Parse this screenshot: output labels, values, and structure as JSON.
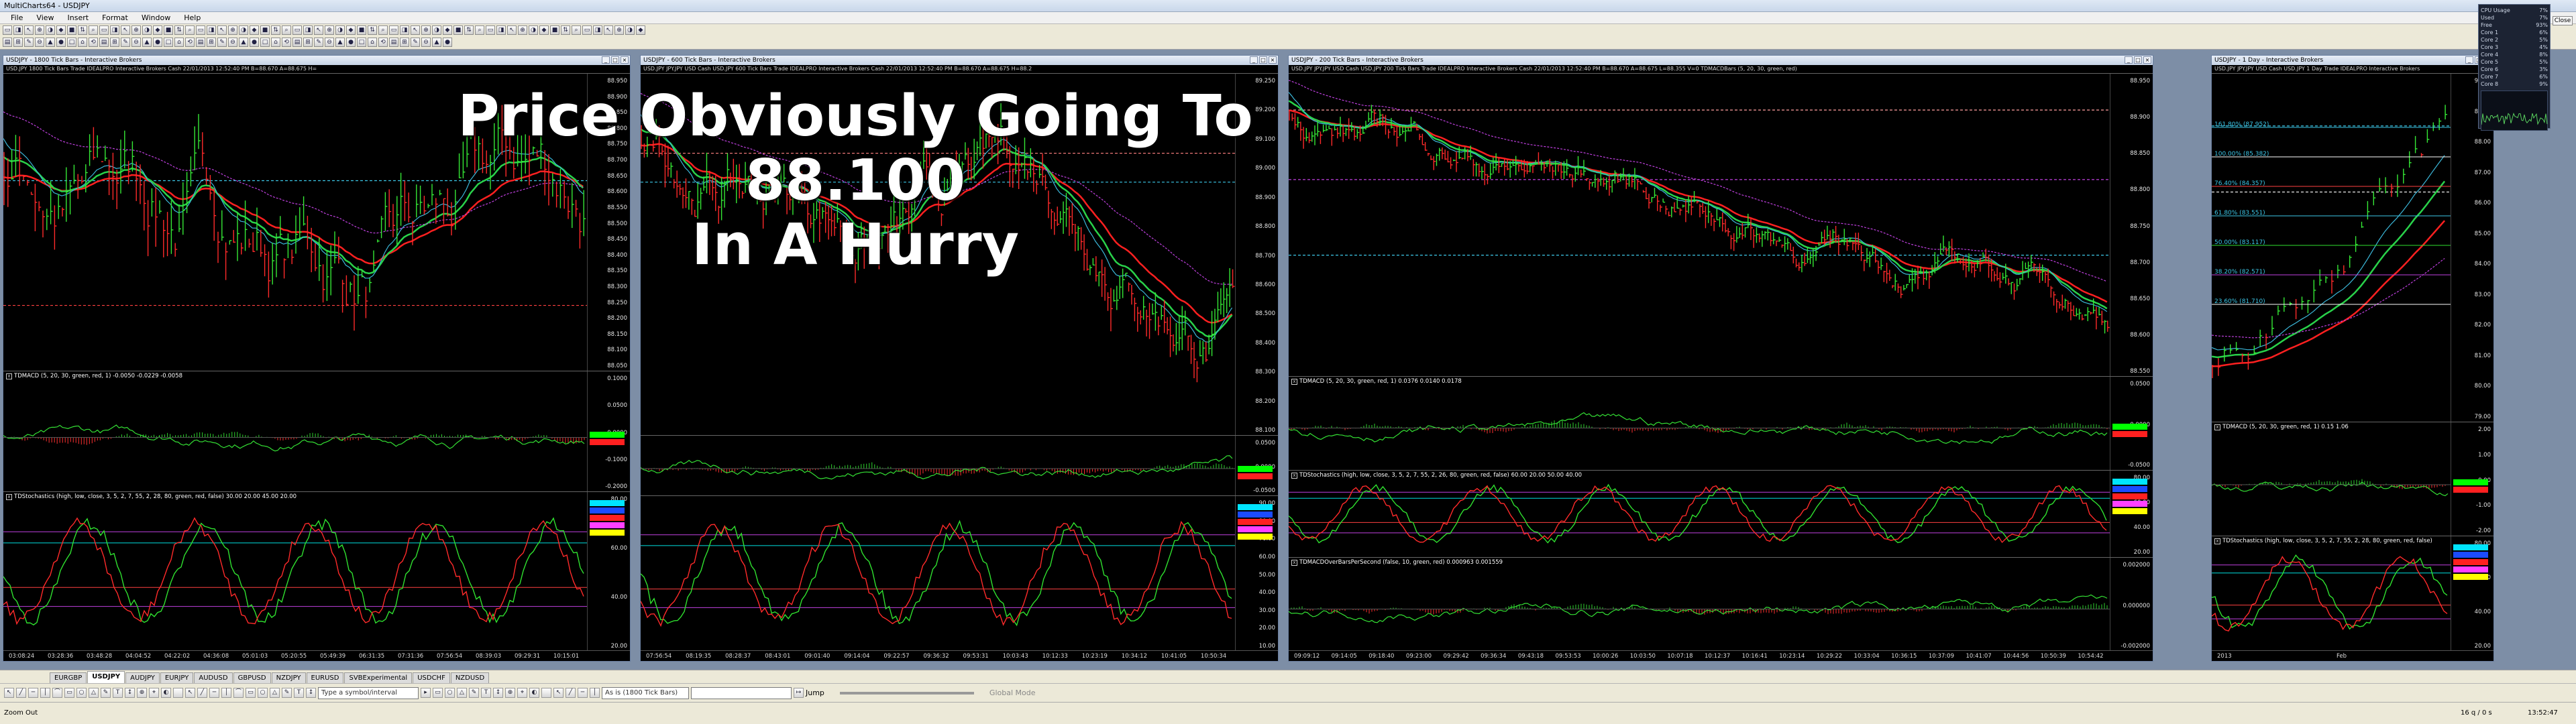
{
  "app": {
    "title": "MultiCharts64 - USDJPY"
  },
  "menu": [
    "File",
    "View",
    "Insert",
    "Format",
    "Window",
    "Help"
  ],
  "overlay": {
    "line1": "Price Obviously Going To 88.100",
    "line2": "In A Hurry"
  },
  "windows": [
    {
      "title": "USDJPY - 1800 Tick Bars - Interactive Brokers",
      "info": "USD.JPY  1800 Tick Bars   Trade  IDEALPRO  Interactive Brokers  Cash  22/01/2013  12:52:40 PM  B=88.670  A=88.675  H=",
      "prices": [
        "88.950",
        "88.900",
        "88.850",
        "88.800",
        "88.750",
        "88.700",
        "88.650",
        "88.600",
        "88.550",
        "88.500",
        "88.450",
        "88.400",
        "88.350",
        "88.300",
        "88.250",
        "88.200",
        "88.150",
        "88.100",
        "88.050"
      ],
      "macd_label": "TDMACD (5, 20, 30, green, red, 1)  -0.0050  -0.0229  -0.0058",
      "macd_ticks": [
        "0.1000",
        "0.0500",
        "0.0000",
        "-0.1000",
        "-0.2000"
      ],
      "stoch_label": "TDStochastics (high, low, close, 3, 5, 2, 7, 55, 2, 28, 80, green, red, false)  30.00  20.00  45.00  20.00",
      "stoch_ticks": [
        "80.00",
        "60.00",
        "40.00",
        "20.00"
      ],
      "times": [
        "03:08:24",
        "03:28:36",
        "03:48:28",
        "04:04:52",
        "04:22:02",
        "04:36:08",
        "05:01:03",
        "05:20:55",
        "05:49:39",
        "06:31:35",
        "07:31:36",
        "07:56:54",
        "08:39:03",
        "09:29:31",
        "10:15:01"
      ]
    },
    {
      "title": "USDJPY - 600 Tick Bars - Interactive Brokers",
      "info": "USD.JPY  JPY.JPY USD Cash USD.JPY  600 Tick Bars   Trade  IDEALPRO  Interactive Brokers  Cash  22/01/2013  12:52:40 PM  B=88.670  A=88.675  H=88.2",
      "prices": [
        "89.250",
        "89.200",
        "89.100",
        "89.000",
        "88.900",
        "88.800",
        "88.700",
        "88.600",
        "88.500",
        "88.400",
        "88.300",
        "88.200",
        "88.100"
      ],
      "macd_label": "",
      "macd_ticks": [
        "0.0500",
        "0.0000",
        "-0.0500"
      ],
      "stoch_label": "",
      "stoch_ticks": [
        "90.00",
        "80.00",
        "70.00",
        "60.00",
        "50.00",
        "40.00",
        "30.00",
        "20.00",
        "10.00"
      ],
      "times": [
        "07:56:54",
        "08:19:35",
        "08:28:37",
        "08:43:01",
        "09:01:40",
        "09:14:04",
        "09:22:57",
        "09:36:32",
        "09:53:31",
        "10:03:43",
        "10:12:33",
        "10:23:19",
        "10:34:12",
        "10:41:05",
        "10:50:34"
      ]
    },
    {
      "title": "USDJPY - 200 Tick Bars - Interactive Brokers",
      "info": "USD.JPY  JPY.JPY USD Cash USD.JPY  200 Tick Bars   Trade  IDEALPRO  Interactive Brokers  Cash  22/01/2013  12:52:40 PM  B=88.670  A=88.675  L=88.355  V=0   TDMACDBars (5, 20, 30, green, red)",
      "prices": [
        "88.950",
        "88.900",
        "88.850",
        "88.800",
        "88.750",
        "88.700",
        "88.650",
        "88.600",
        "88.550"
      ],
      "macd_label": "TDMACD (5, 20, 30, green, red, 1)  0.0376  0.0140  0.0178",
      "macd_ticks": [
        "0.0500",
        "0.0000",
        "-0.0500"
      ],
      "stoch_label": "TDStochastics (high, low, close, 3, 5, 2, 7, 55, 2, 26, 80, green, red, false)  60.00  20.00  50.00  40.00",
      "stoch_ticks": [
        "80.00",
        "60.00",
        "40.00",
        "20.00"
      ],
      "extra_label": "TDMACDOverBarsPerSecond (false, 10, green, red)  0.000963  0.001559",
      "extra_ticks": [
        "0.002000",
        "0.000000",
        "-0.002000"
      ],
      "times": [
        "09:09:12",
        "09:14:05",
        "09:18:40",
        "09:23:00",
        "09:29:42",
        "09:36:34",
        "09:43:18",
        "09:53:53",
        "10:00:26",
        "10:03:50",
        "10:07:18",
        "10:12:37",
        "10:16:41",
        "10:23:14",
        "10:29:22",
        "10:33:04",
        "10:36:15",
        "10:37:09",
        "10:41:07",
        "10:44:56",
        "10:50:39",
        "10:54:42"
      ]
    },
    {
      "title": "USDJPY - 1 Day - Interactive Brokers",
      "info": "USD.JPY  JPY.JPY USD Cash USD.JPY  1 Day   Trade  IDEALPRO  Interactive Brokers",
      "prices": [
        "90.00",
        "89.00",
        "88.00",
        "87.00",
        "86.00",
        "85.00",
        "84.00",
        "83.00",
        "82.00",
        "81.00",
        "80.00",
        "79.00"
      ],
      "fib": [
        "161.80% (87.952)",
        "100.00% (85.382)",
        "76.40% (84.357)",
        "61.80% (83.551)",
        "50.00% (83.117)",
        "38.20% (82.571)",
        "23.60% (81.710)"
      ],
      "macd_label": "TDMACD (5, 20, 30, green, red, 1)  0.15  1.06",
      "macd_ticks": [
        "2.00",
        "1.00",
        "0.00",
        "-1.00",
        "-2.00"
      ],
      "stoch_label": "TDStochastics (high, low, close, 3, 5, 2, 7, 55, 2, 28, 80, green, red, false)",
      "stoch_ticks": [
        "80.00",
        "60.00",
        "40.00",
        "20.00"
      ],
      "times": [
        "2013",
        "Feb"
      ]
    }
  ],
  "cpu": {
    "title": "CPU Usage",
    "value": "7%",
    "rows": [
      [
        "Used",
        "7%"
      ],
      [
        "Free",
        "93%"
      ],
      [
        "Core 1",
        "6%"
      ],
      [
        "Core 2",
        "5%"
      ],
      [
        "Core 3",
        "4%"
      ],
      [
        "Core 4",
        "8%"
      ],
      [
        "Core 5",
        "5%"
      ],
      [
        "Core 6",
        "3%"
      ],
      [
        "Core 7",
        "6%"
      ],
      [
        "Core 8",
        "9%"
      ]
    ],
    "close": "Close"
  },
  "tabs": [
    "EURGBP",
    "USDJPY",
    "AUDJPY",
    "EURJPY",
    "AUDUSD",
    "GBPUSD",
    "NZDJPY",
    "EURUSD",
    "SVBExperimental",
    "USDCHF",
    "NZDUSD"
  ],
  "active_tab": "USDJPY",
  "drawbar": {
    "symbol_placeholder": "Type a symbol/interval",
    "interval": "As is (1800 Tick Bars)",
    "jump": "Jump",
    "global": "Global Mode"
  },
  "status": {
    "left": "Zoom Out",
    "right_a": "16 q / 0 s",
    "right_b": "13:52:47"
  }
}
